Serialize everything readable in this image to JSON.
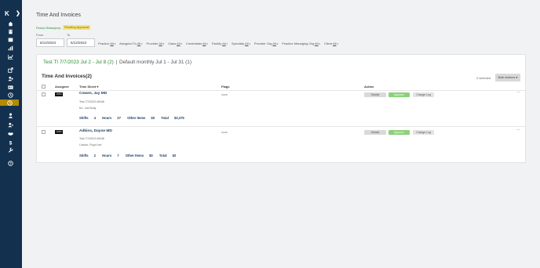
{
  "sidebar": {
    "logo": "K",
    "nav_icons": [
      "home-icon",
      "building-icon",
      "calendar-icon",
      "chart-bar-icon",
      "chart-line-icon",
      "export-icon",
      "add-user-icon",
      "id-card-icon",
      "clock-icon",
      "active-clock-icon",
      "person-icon",
      "user-plus-icon",
      "handshake-icon",
      "dollar-icon",
      "wrench-icon",
      "help-icon"
    ]
  },
  "page": {
    "title": "Time And Invoices",
    "period_status_label": "Period Status(es):",
    "period_status_value": "Pending Approval",
    "from_label": "From",
    "to_label": "To",
    "from_value": "6/12/2023",
    "to_value": "6/12/2023"
  },
  "filters": [
    {
      "label": "Practice",
      "value": "All"
    },
    {
      "label": "Assigned To",
      "value": "All"
    },
    {
      "label": "Provider",
      "value": "All"
    },
    {
      "label": "Class",
      "value": "All"
    },
    {
      "label": "Credentials",
      "value": "All"
    },
    {
      "label": "Facility",
      "value": "All"
    },
    {
      "label": "Specialty",
      "value": "All"
    },
    {
      "label": "Provider Org",
      "value": "All"
    },
    {
      "label": "Practice Managing Org",
      "value": "All"
    },
    {
      "label": "Client",
      "value": "All"
    }
  ],
  "card": {
    "run_link": "Test TI 7/7/2023 Jul 2 - Jul 8 (2)",
    "run_sep": "|",
    "run_rest": "Default monthly Jul 1 - Jul 31 (1)",
    "section_title": "Time And Invoices(2)",
    "selected": "0 selected",
    "bulk_actions": "Bulk Actions ▾",
    "columns": {
      "assignee": "Assignee",
      "timesheet": "Time Sheet ▾",
      "flags": "Flags",
      "action": "Action"
    },
    "buttons": {
      "details": "Details",
      "approve": "Approve",
      "change_log": "Change Log"
    },
    "stat_labels": {
      "shifts": "Shifts",
      "hours": "Hours",
      "other": "Other Items",
      "total": "Total"
    }
  },
  "rows": [
    {
      "assignee": "JOHN",
      "name": "Cowen, Jay MD",
      "sub1": "Test 7/7/2023 #9048",
      "sub2": "M.I. Joe Body",
      "shifts": "4",
      "hours": "27",
      "other": "$0",
      "total": "$3,375",
      "flags": "none"
    },
    {
      "assignee": "JOHN",
      "name": "Adkins, Dayne MD",
      "sub1": "Test 7/7/2023 #9048",
      "sub2": "Lincoln, Floyd Lee",
      "shifts": "2",
      "hours": "7",
      "other": "$0",
      "total": "$0",
      "flags": "none"
    }
  ]
}
